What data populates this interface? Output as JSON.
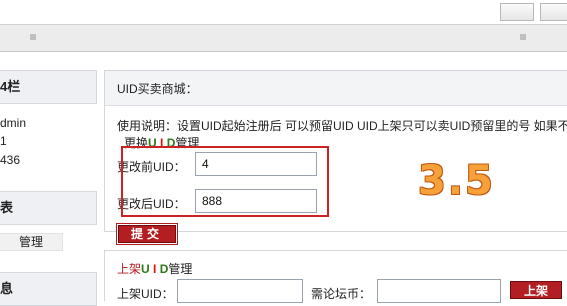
{
  "sidebar": {
    "heading1": "4栏",
    "line1": "dmin",
    "line2": "1",
    "line3": "436",
    "heading2": "表",
    "manage_link": "管理",
    "heading3": "息"
  },
  "main": {
    "title": "UID买卖商城：",
    "description": "使用说明：设置UID起始注册后 可以预留UID UID上架只可以卖UID预留里的号 如果不",
    "change_link": {
      "p1": "更换",
      "u": "U",
      "i": "I",
      "d": "D",
      "p2": "管理"
    },
    "before_label": "更改前UID：",
    "before_value": "4",
    "after_label": "更改后UID：",
    "after_value": "888",
    "annotation": "3.5",
    "submit_label": "提交"
  },
  "shelf": {
    "title": {
      "p1": "上架",
      "u": "U",
      "i": "I",
      "d": "D",
      "p2": "管理"
    },
    "uid_label": "上架UID：",
    "currency_label": "需论坛币：",
    "button_label": "上架"
  },
  "colors": {
    "accent_red": "#b21e22",
    "highlight_red": "#cc2222",
    "link_green": "#2f7a18",
    "annotation_orange": "#f6a13a"
  }
}
